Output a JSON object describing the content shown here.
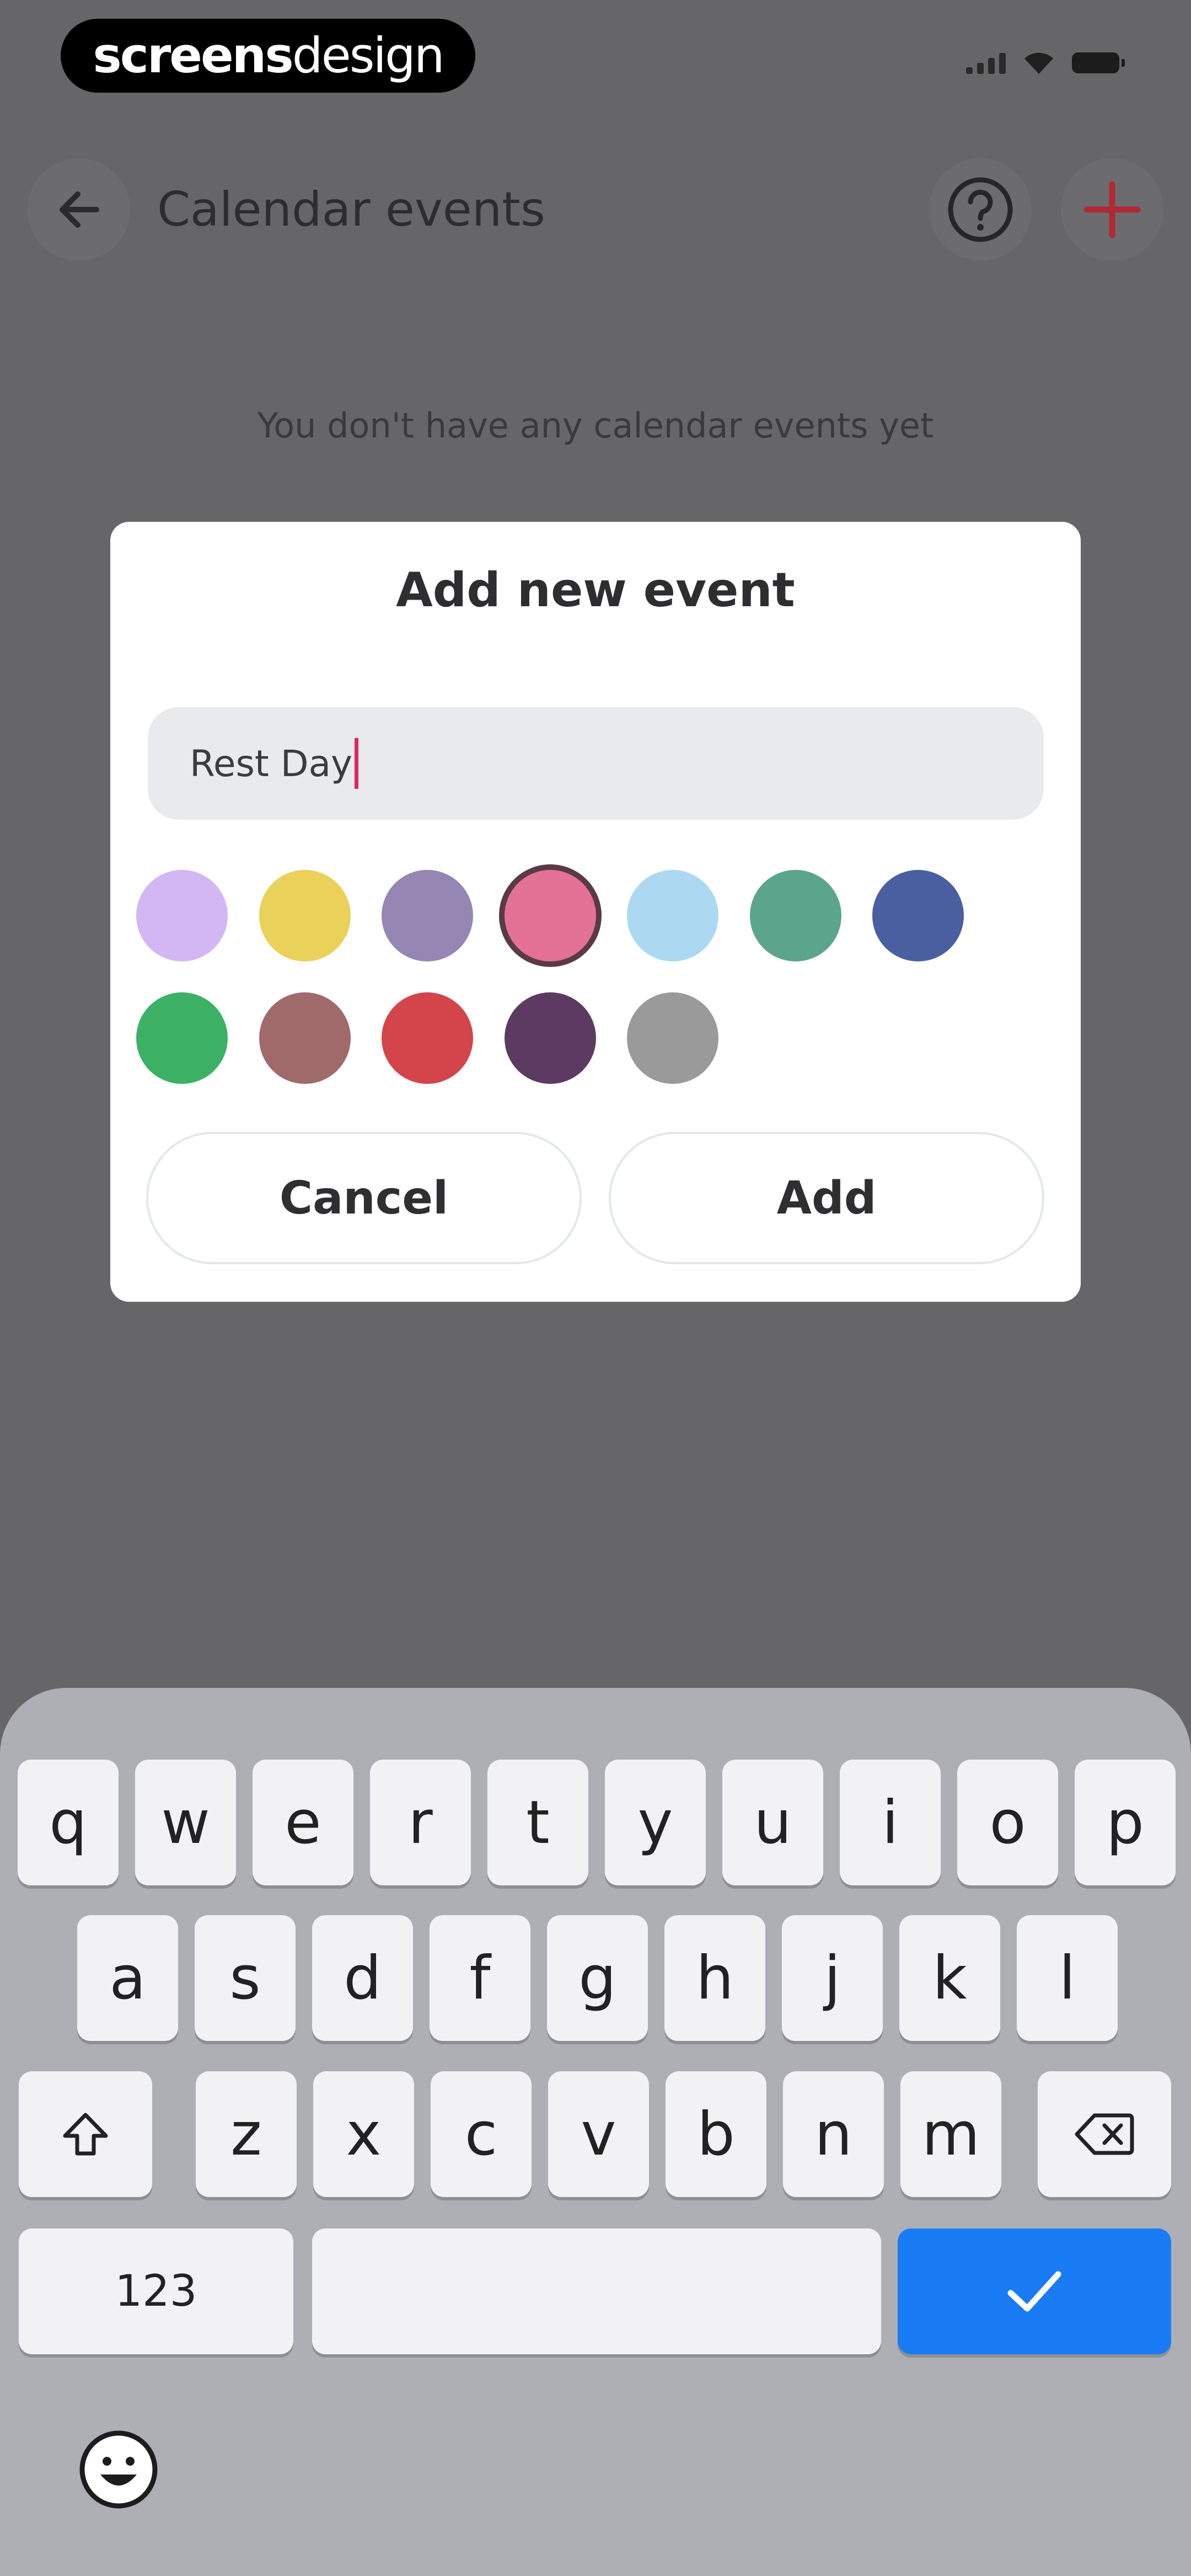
{
  "status_bar": {
    "brand_bold": "screens",
    "brand_light": "design",
    "icons": [
      "signal-icon",
      "wifi-icon",
      "battery-icon"
    ]
  },
  "header": {
    "title": "Calendar events",
    "back_icon": "arrow-left-icon",
    "help_icon": "question-circle-icon",
    "add_icon": "plus-icon"
  },
  "empty_state": {
    "message": "You don't have any calendar events yet"
  },
  "dialog": {
    "title": "Add new event",
    "input_value": "Rest Day",
    "colors": [
      "#d3b7f2",
      "#e9d15a",
      "#9586b4",
      "#e47196",
      "#acd9f1",
      "#5aa58b",
      "#4a5f9f",
      "#3cb165",
      "#a06a6b",
      "#d3454b",
      "#5c3a62",
      "#9a9a9b"
    ],
    "selected_color": "#e47196",
    "cancel_label": "Cancel",
    "confirm_label": "Add"
  },
  "keyboard": {
    "row1": [
      "q",
      "w",
      "e",
      "r",
      "t",
      "y",
      "u",
      "i",
      "o",
      "p"
    ],
    "row2": [
      "a",
      "s",
      "d",
      "f",
      "g",
      "h",
      "j",
      "k",
      "l"
    ],
    "row3": [
      "z",
      "x",
      "c",
      "v",
      "b",
      "n",
      "m"
    ],
    "numbers_label": "123",
    "done_icon": "checkmark-icon",
    "shift_icon": "shift-icon",
    "delete_icon": "backspace-icon",
    "emoji_icon": "emoji-icon",
    "accent": "#1a7cf5"
  }
}
